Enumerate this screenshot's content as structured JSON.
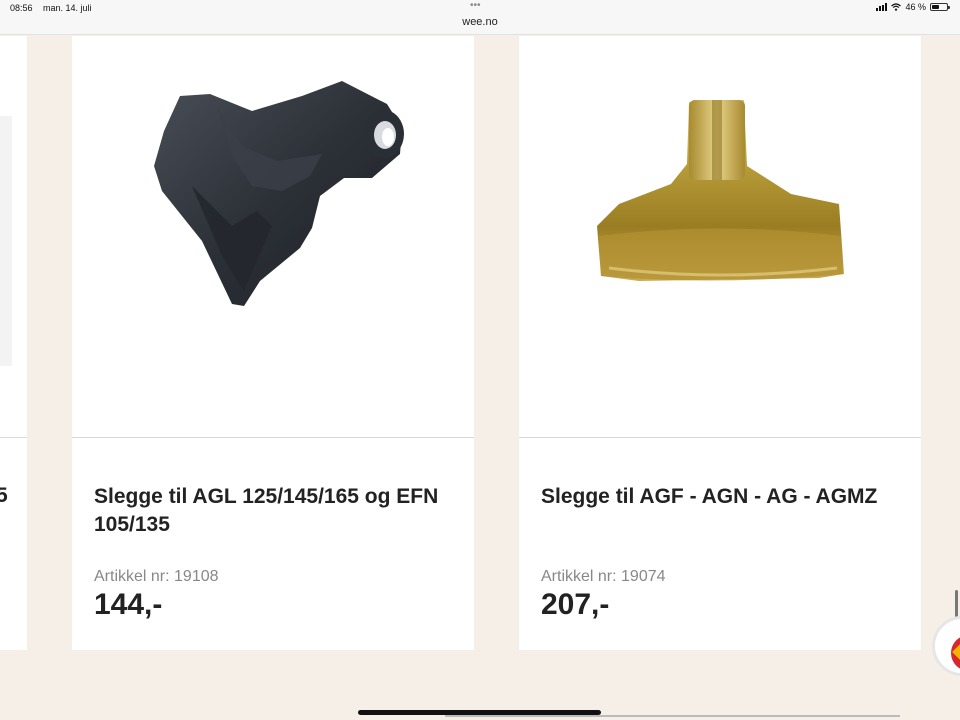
{
  "status_bar": {
    "time": "08:56",
    "date": "man. 14. juli",
    "dots": "•••",
    "url": "wee.no",
    "battery": "46 %"
  },
  "left_partial": {
    "clipped_text": "5"
  },
  "products": [
    {
      "title": "Slegge til AGL 125/145/165 og EFN 105/135",
      "article": "Artikkel nr: 19108",
      "price": "144,-"
    },
    {
      "title": "Slegge til AGF - AGN - AG - AGMZ",
      "article": "Artikkel nr: 19074",
      "price": "207,-"
    }
  ],
  "colors": {
    "background": "#f5efe8",
    "card": "#ffffff",
    "text": "#222222",
    "muted": "#888888"
  }
}
